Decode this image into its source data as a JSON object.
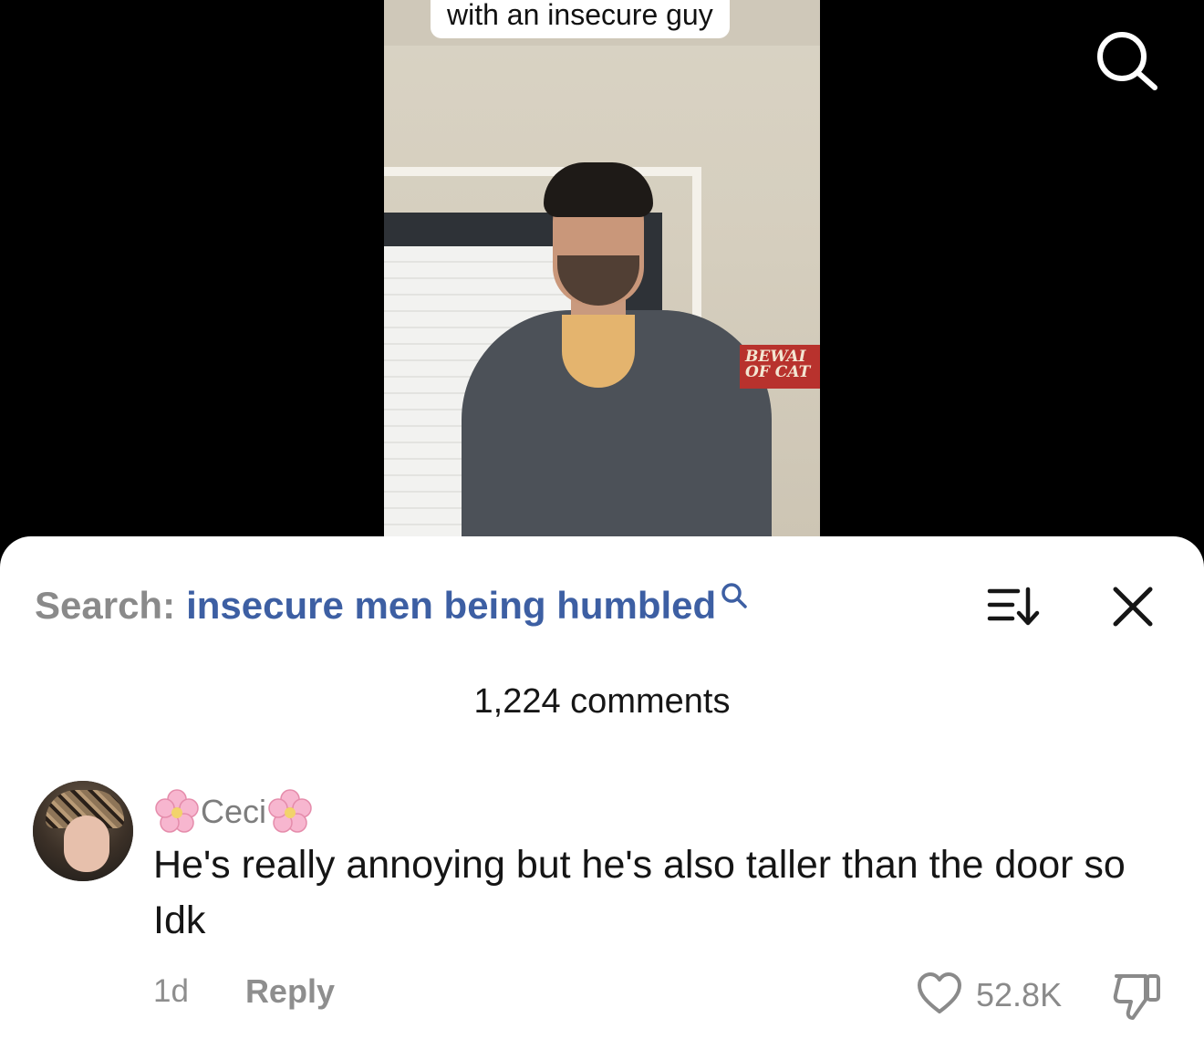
{
  "video": {
    "caption": "with an insecure guy",
    "sign_text_line1": "BEWAI",
    "sign_text_line2": "OF CAT"
  },
  "search_panel": {
    "prefix": "Search:",
    "query": "insecure men being humbled",
    "comment_count": "1,224 comments"
  },
  "comment": {
    "username": "Ceci",
    "text": "He's really annoying but he's also taller than the door so Idk",
    "time": "1d",
    "reply_label": "Reply",
    "like_count": "52.8K"
  },
  "icons": {
    "top_search": "search-icon",
    "query_search": "search-icon",
    "sort": "sort-icon",
    "close": "close-icon",
    "like": "heart-icon",
    "dislike": "thumbs-down-icon",
    "flower": "cherry-blossom-icon"
  },
  "colors": {
    "query_link": "#3d5fa3",
    "muted_text": "#8a8a8a",
    "sheet_background": "#ffffff"
  }
}
